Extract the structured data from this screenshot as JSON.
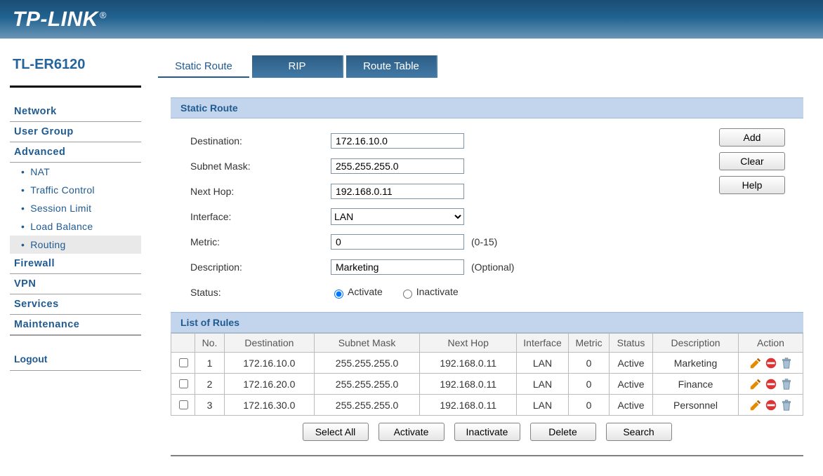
{
  "brand": "TP-LINK",
  "model": "TL-ER6120",
  "sidebar": {
    "items": [
      {
        "label": "Network",
        "type": "main"
      },
      {
        "label": "User Group",
        "type": "main"
      },
      {
        "label": "Advanced",
        "type": "main",
        "expanded": true
      },
      {
        "label": "NAT",
        "type": "sub"
      },
      {
        "label": "Traffic Control",
        "type": "sub"
      },
      {
        "label": "Session Limit",
        "type": "sub"
      },
      {
        "label": "Load Balance",
        "type": "sub"
      },
      {
        "label": "Routing",
        "type": "sub",
        "active": true
      },
      {
        "label": "Firewall",
        "type": "main"
      },
      {
        "label": "VPN",
        "type": "main"
      },
      {
        "label": "Services",
        "type": "main"
      },
      {
        "label": "Maintenance",
        "type": "main"
      }
    ],
    "logout": "Logout"
  },
  "tabs": [
    {
      "label": "Static Route",
      "active": true
    },
    {
      "label": "RIP"
    },
    {
      "label": "Route Table"
    }
  ],
  "section": {
    "static_route_header": "Static Route",
    "form": {
      "destination_label": "Destination:",
      "destination_value": "172.16.10.0",
      "subnet_label": "Subnet Mask:",
      "subnet_value": "255.255.255.0",
      "nexthop_label": "Next Hop:",
      "nexthop_value": "192.168.0.11",
      "interface_label": "Interface:",
      "interface_value": "LAN",
      "metric_label": "Metric:",
      "metric_value": "0",
      "metric_hint": "(0-15)",
      "description_label": "Description:",
      "description_value": "Marketing",
      "description_hint": "(Optional)",
      "status_label": "Status:",
      "status_activate": "Activate",
      "status_inactivate": "Inactivate",
      "status_selected": "activate"
    },
    "buttons": {
      "add": "Add",
      "clear": "Clear",
      "help": "Help"
    },
    "rules_header": "List of Rules",
    "columns": {
      "no": "No.",
      "destination": "Destination",
      "subnet": "Subnet Mask",
      "nexthop": "Next Hop",
      "interface": "Interface",
      "metric": "Metric",
      "status": "Status",
      "description": "Description",
      "action": "Action"
    },
    "rows": [
      {
        "no": "1",
        "dest": "172.16.10.0",
        "mask": "255.255.255.0",
        "hop": "192.168.0.11",
        "iface": "LAN",
        "metric": "0",
        "status": "Active",
        "desc": "Marketing"
      },
      {
        "no": "2",
        "dest": "172.16.20.0",
        "mask": "255.255.255.0",
        "hop": "192.168.0.11",
        "iface": "LAN",
        "metric": "0",
        "status": "Active",
        "desc": "Finance"
      },
      {
        "no": "3",
        "dest": "172.16.30.0",
        "mask": "255.255.255.0",
        "hop": "192.168.0.11",
        "iface": "LAN",
        "metric": "0",
        "status": "Active",
        "desc": "Personnel"
      }
    ],
    "table_buttons": {
      "select_all": "Select All",
      "activate": "Activate",
      "inactivate": "Inactivate",
      "delete": "Delete",
      "search": "Search"
    }
  }
}
